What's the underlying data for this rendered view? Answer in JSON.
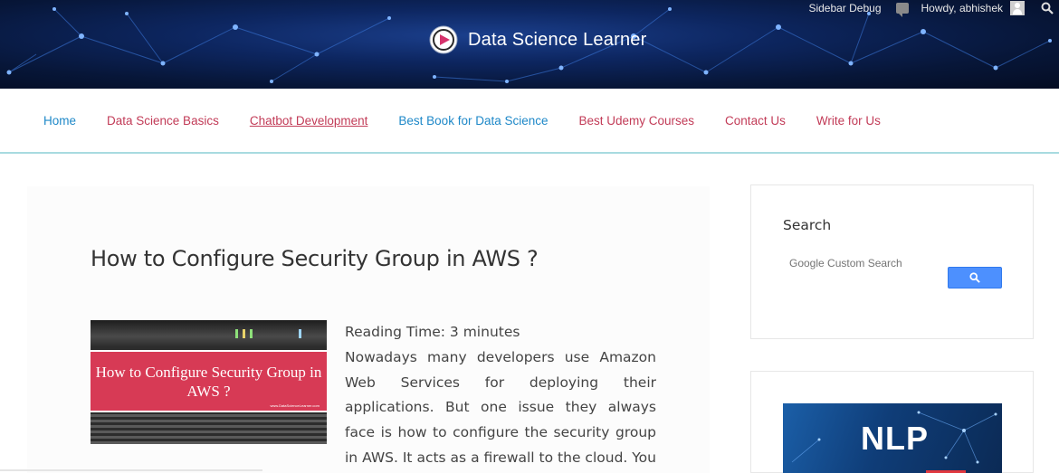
{
  "topbar": {
    "debug_label": "Sidebar Debug",
    "greeting": "Howdy, abhishek"
  },
  "brand": {
    "site_name": "Data Science Learner"
  },
  "nav": {
    "items": [
      {
        "label": "Home"
      },
      {
        "label": "Data Science Basics"
      },
      {
        "label": "Chatbot Development"
      },
      {
        "label": "Best Book for Data Science"
      },
      {
        "label": "Best Udemy Courses"
      },
      {
        "label": "Contact Us"
      },
      {
        "label": "Write for Us"
      }
    ]
  },
  "post": {
    "title": "How to Configure Security Group in AWS ?",
    "thumbnail_text": "How to Configure Security Group in AWS ?",
    "thumbnail_url": "www.DataScienceLearner.com",
    "reading_time": "Reading Time: 3 minutes",
    "excerpt": "Nowadays many developers use Amazon Web Services for deploying their applications. But one issue they always face is how to configure the security group in AWS. It acts as a firewall to the cloud. You can be in"
  },
  "sidebar": {
    "search_title": "Search",
    "search_placeholder": "Google Custom Search",
    "nlp_banner_text": "NLP"
  },
  "colors": {
    "nav_blue": "#1e88c8",
    "nav_red": "#c23b57",
    "search_button": "#4d90fe",
    "thumb_red": "#d73a55"
  }
}
